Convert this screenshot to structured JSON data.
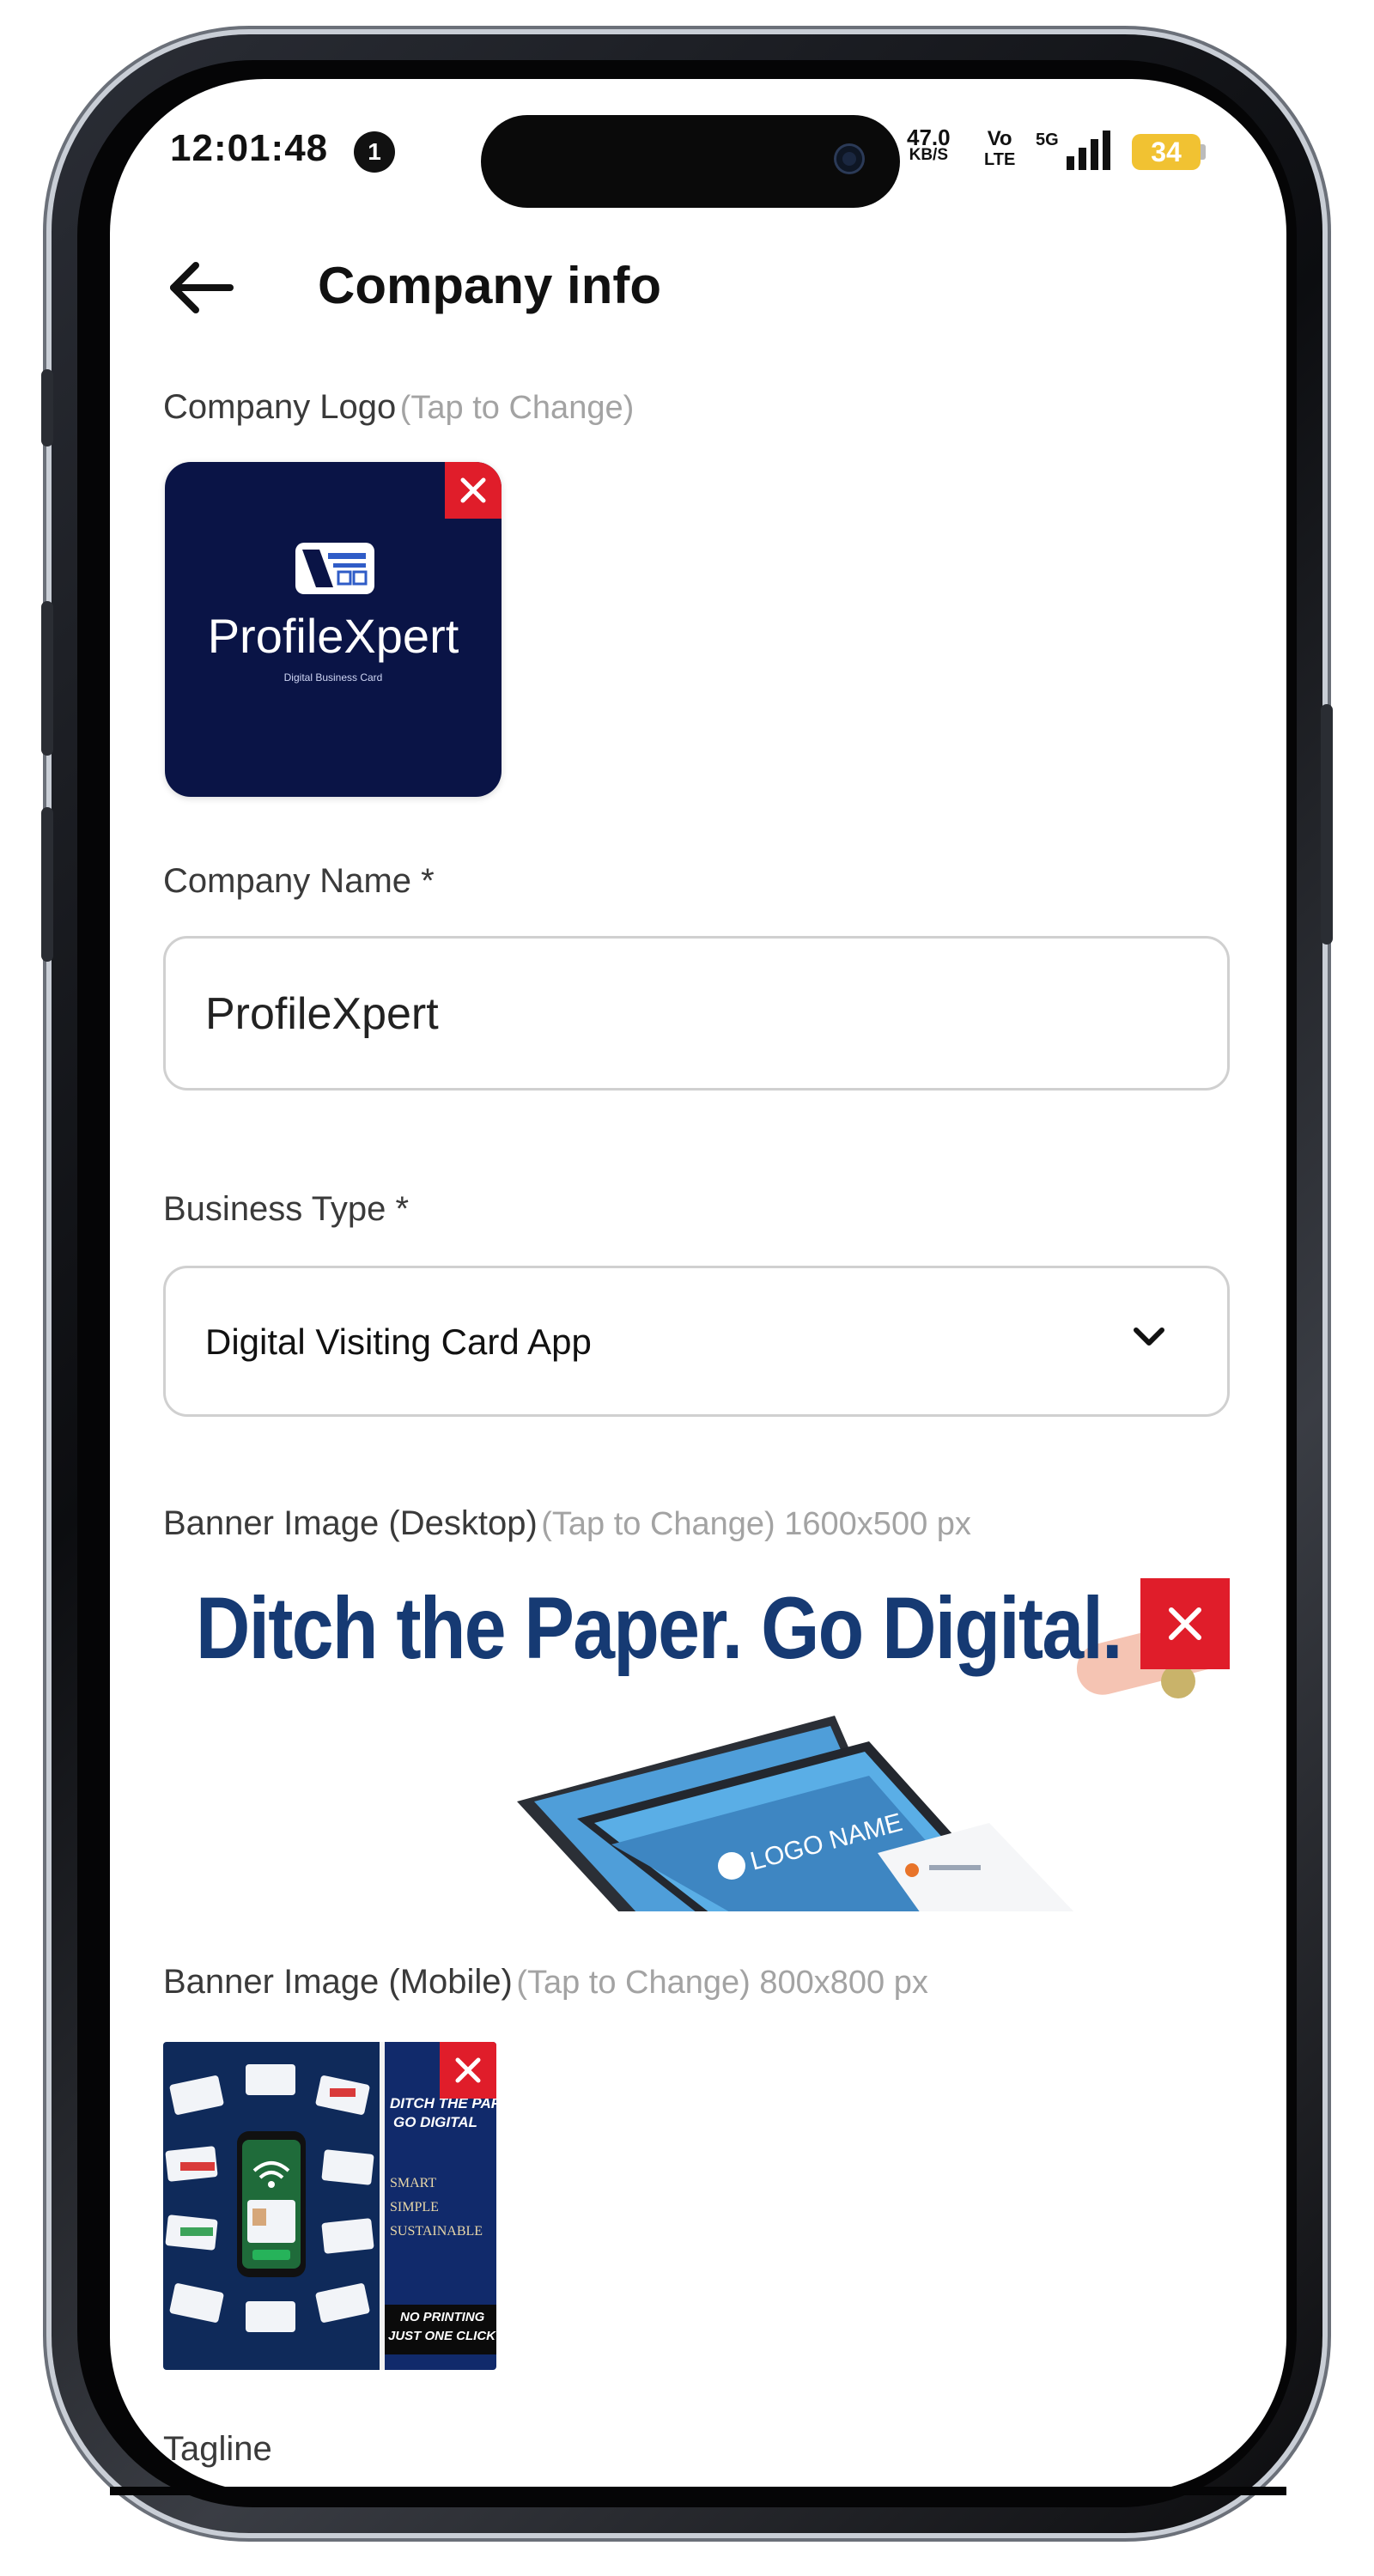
{
  "status_bar": {
    "time": "12:01:48",
    "notification_count": "1",
    "speed_value": "47.0",
    "speed_unit": "KB/S",
    "volte_top": "Vo",
    "volte_bottom": "LTE",
    "network": "5G",
    "battery": "34"
  },
  "header": {
    "title": "Company info"
  },
  "company_logo": {
    "label": "Company Logo",
    "hint": "(Tap to Change)",
    "logo_text": "ProfileXpert",
    "logo_subtext": "Digital Business Card"
  },
  "company_name": {
    "label": "Company Name *",
    "value": "ProfileXpert"
  },
  "business_type": {
    "label": "Business Type *",
    "value": "Digital Visiting Card App"
  },
  "banner_desktop": {
    "label": "Banner Image (Desktop)",
    "hint": "(Tap to Change) 1600x500 px",
    "headline": "Ditch the Paper. Go Digital.",
    "card_text": "LOGO NAME"
  },
  "banner_mobile": {
    "label": "Banner Image (Mobile)",
    "hint": "(Tap to Change) 800x800 px",
    "headline_1": "DITCH THE PAPER",
    "headline_2": "GO DIGITAL",
    "line_1": "SMART",
    "line_2": "SIMPLE",
    "line_3": "SUSTAINABLE",
    "footer_1": "NO PRINTING",
    "footer_2": "JUST ONE CLICK"
  },
  "tagline": {
    "label": "Tagline"
  },
  "colors": {
    "accent_red": "#e01d2a",
    "logo_bg": "#0a1446",
    "banner_text": "#163a73",
    "battery": "#f1c232"
  }
}
